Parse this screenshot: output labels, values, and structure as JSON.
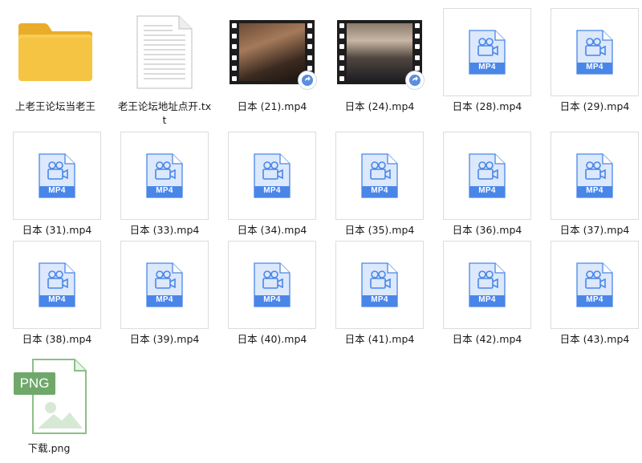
{
  "files": [
    {
      "name": "上老王论坛当老王",
      "type": "folder",
      "icon": "folder-icon"
    },
    {
      "name": "老王论坛地址点开.txt",
      "type": "txt",
      "icon": "text-document-icon"
    },
    {
      "name": "日本 (21).mp4",
      "type": "video-thumb",
      "icon": "video-thumbnail"
    },
    {
      "name": "日本 (24).mp4",
      "type": "video-thumb",
      "icon": "video-thumbnail"
    },
    {
      "name": "日本 (28).mp4",
      "type": "mp4",
      "icon": "mp4-file-icon"
    },
    {
      "name": "日本 (29).mp4",
      "type": "mp4",
      "icon": "mp4-file-icon"
    },
    {
      "name": "日本 (31).mp4",
      "type": "mp4",
      "icon": "mp4-file-icon"
    },
    {
      "name": "日本 (33).mp4",
      "type": "mp4",
      "icon": "mp4-file-icon"
    },
    {
      "name": "日本 (34).mp4",
      "type": "mp4",
      "icon": "mp4-file-icon"
    },
    {
      "name": "日本 (35).mp4",
      "type": "mp4",
      "icon": "mp4-file-icon"
    },
    {
      "name": "日本 (36).mp4",
      "type": "mp4",
      "icon": "mp4-file-icon"
    },
    {
      "name": "日本 (37).mp4",
      "type": "mp4",
      "icon": "mp4-file-icon"
    },
    {
      "name": "日本 (38).mp4",
      "type": "mp4",
      "icon": "mp4-file-icon"
    },
    {
      "name": "日本 (39).mp4",
      "type": "mp4",
      "icon": "mp4-file-icon"
    },
    {
      "name": "日本 (40).mp4",
      "type": "mp4",
      "icon": "mp4-file-icon"
    },
    {
      "name": "日本 (41).mp4",
      "type": "mp4",
      "icon": "mp4-file-icon"
    },
    {
      "name": "日本 (42).mp4",
      "type": "mp4",
      "icon": "mp4-file-icon"
    },
    {
      "name": "日本 (43).mp4",
      "type": "mp4",
      "icon": "mp4-file-icon"
    },
    {
      "name": "下载.png",
      "type": "png",
      "icon": "png-file-icon"
    }
  ],
  "icon_texts": {
    "mp4": "MP4",
    "png": "PNG"
  },
  "colors": {
    "mp4_blue": "#4a86e8",
    "mp4_light": "#dce8fb",
    "folder_yellow": "#f6c443",
    "png_green": "#6fa86a"
  }
}
